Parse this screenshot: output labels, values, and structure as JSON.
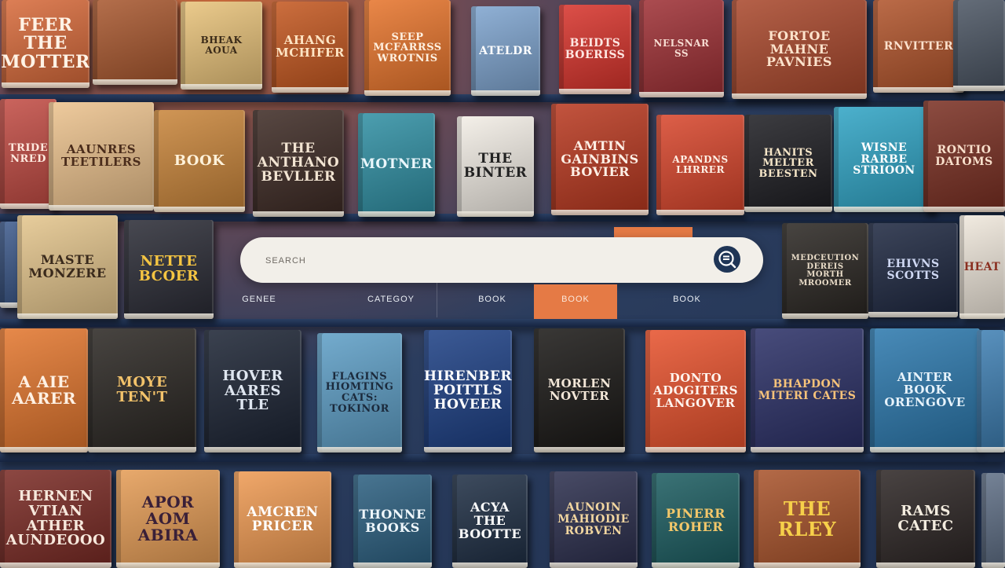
{
  "search": {
    "placeholder": "SEARCH"
  },
  "tabs": [
    {
      "label": "GENEE"
    },
    {
      "label": "CATEGOY"
    },
    {
      "label": "BOOK"
    },
    {
      "label": "BOOK"
    },
    {
      "label": "BOOK"
    }
  ],
  "books": [
    {
      "title": "FEER\nTHE\nMOTTER",
      "cover": "#d86a3a"
    },
    {
      "title": "",
      "cover": "#a8572e"
    },
    {
      "title": "BHEAK\nAOUA",
      "cover": "#e9c37a"
    },
    {
      "title": "AHANG\nMCHIFER",
      "cover": "#c4571f"
    },
    {
      "title": "SEEP\nMCFARRSS\nWROTNIS",
      "cover": "#e7742b"
    },
    {
      "title": "ATELDR",
      "cover": "#7ea4cf"
    },
    {
      "title": "BEIDTS\nBOERISS",
      "cover": "#d8332b"
    },
    {
      "title": "NELSNAR\nSS",
      "cover": "#9e2f34"
    },
    {
      "title": "FORTOE\nMAHNE\nPAVNIES",
      "cover": "#a9472b"
    },
    {
      "title": "RNVITTER",
      "cover": "#b0532a"
    },
    {
      "title": "",
      "cover": "#4b5563"
    },
    {
      "title": "TRIDE\nNRED",
      "cover": "#c24b43"
    },
    {
      "title": "AAUNRES\nTEETILERS",
      "cover": "#ecc28d"
    },
    {
      "title": "BOOK",
      "cover": "#c9853a"
    },
    {
      "title": "THE\nANTHANO\nBEVLLER",
      "cover": "#3d2a24"
    },
    {
      "title": "MOTNER",
      "cover": "#2f8fa3"
    },
    {
      "title": "THE\nBINTER",
      "cover": "#f3eee6"
    },
    {
      "title": "AMTIN\nGAINBINS\nBOVIER",
      "cover": "#b9381f"
    },
    {
      "title": "APANDNS\nLHRRER",
      "cover": "#d8452b"
    },
    {
      "title": "HANITS\nMELTER\nBEESTEN",
      "cover": "#1d1d22"
    },
    {
      "title": "WISNE\nRARBE\nSTRIOON",
      "cover": "#2fa4c5"
    },
    {
      "title": "RONTIO\nDATOMS",
      "cover": "#7a2f22"
    },
    {
      "title": "",
      "cover": "#3d5a8c"
    },
    {
      "title": "MASTE\nMONZERE",
      "cover": "#e4c58c"
    },
    {
      "title": "NETTE\nBCOER",
      "cover": "#2a2b35"
    },
    {
      "title": "MEDCEUTION\nDEREIS\nMORTH\nMROOMER",
      "cover": "#2a2622"
    },
    {
      "title": "EHIVNS\nSCOTTS",
      "cover": "#1d2740"
    },
    {
      "title": "HEAT",
      "cover": "#f0e8dc"
    },
    {
      "title": "A AIE\nAARER",
      "cover": "#e3762d"
    },
    {
      "title": "MOYE\nTEN'T",
      "cover": "#2a2622"
    },
    {
      "title": "HOVER\nAARES\nTLE",
      "cover": "#1b2333"
    },
    {
      "title": "FLAGINS\nHIOMTING\nCATS:\nTOKINOR",
      "cover": "#5d9ec6"
    },
    {
      "title": "HIRENBER\nPOITTLS\nHOVEER",
      "cover": "#1c3f84"
    },
    {
      "title": "MORLEN\nNOVTER",
      "cover": "#191715"
    },
    {
      "title": "DONTO\nADOGITERS\nLANGOVER",
      "cover": "#e7512c"
    },
    {
      "title": "BHAPDON\nMITERI CATES",
      "cover": "#2a2f66"
    },
    {
      "title": "AINTER\nBOOK\nORENGOVE",
      "cover": "#2b78ad"
    },
    {
      "title": "",
      "cover": "#3e7fb3"
    },
    {
      "title": "HERNEN\nVTIAN\nATHER\nAUNDEOOO",
      "cover": "#7a2a24"
    },
    {
      "title": "APOR\nAOM\nABIRA",
      "cover": "#e59c55"
    },
    {
      "title": "AMCREN\nPRICER",
      "cover": "#ef9a52"
    },
    {
      "title": "THONNE\nBOOKS",
      "cover": "#2b5f80"
    },
    {
      "title": "ACYA\nTHE\nBOOTTE",
      "cover": "#1e2e44"
    },
    {
      "title": "AUNOIN\nMAHIODIE\nROBVEN",
      "cover": "#2b2e4d"
    },
    {
      "title": "PINERR\nROHER",
      "cover": "#1b5c60"
    },
    {
      "title": "THE\nRLEY",
      "cover": "#a8522a"
    },
    {
      "title": "RAMS\nCATEC",
      "cover": "#2c2524"
    },
    {
      "title": "",
      "cover": "#5f6f86"
    }
  ]
}
